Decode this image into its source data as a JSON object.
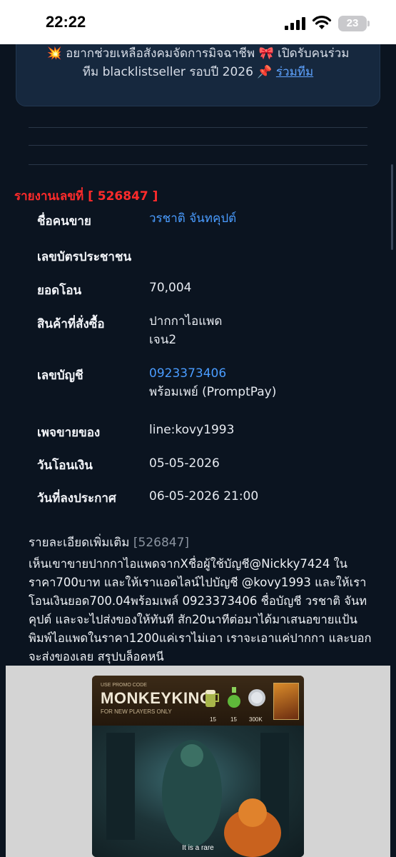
{
  "status_bar": {
    "time": "22:22",
    "battery": "23"
  },
  "banner": {
    "line1": "💥 อยากช่วยเหลือสังคมจัดการมิจฉาชีพ 🎀 เปิดรับคนร่วม",
    "line2": "ทีม blacklistseller รอบปี 2026 📌 ",
    "link": "ร่วมทีม"
  },
  "report": {
    "title": "รายงานเลขที่ [ 526847 ]",
    "rows": [
      {
        "label": "ชื่อคนขาย",
        "value": "วรชาติ จันทคุปต์"
      },
      {
        "label": "เลขบัตรประชาชน",
        "value": ""
      },
      {
        "label": "ยอดโอน",
        "value": "70,004"
      },
      {
        "label": "สินค้าที่สั่งซื้อ",
        "value": "ปากกาไอแพด",
        "value2": "เจน2"
      },
      {
        "label": "เลขบัญชี",
        "value": "0923373406",
        "value2": "พร้อมเพย์ (PromptPay)"
      },
      {
        "label": "เพจขายของ",
        "value": "line:kovy1993"
      },
      {
        "label": "วันโอนเงิน",
        "value": "05-05-2026"
      },
      {
        "label": "วันที่ลงประกาศ",
        "value": "06-05-2026 21:00"
      }
    ]
  },
  "details": {
    "heading": "รายละเอียดเพิ่มเติม ",
    "id": "[526847]",
    "body": "เห็นเขาขายปากกาไอแพดจากXชื่อผู้ใช้บัญชี@Nickky7424 ในราคา700บาท และให้เราแอดไลน์ไปบัญชี @kovy1993 และให้เราโอนเงินยอด700.04พร้อมเพล์ 0923373406 ชื่อบัญชี วรชาติ จันทคุปต์ และจะไปส่งของให้ทันที สัก20นาทีต่อมาได้มาเสนอขายแป้นพิมพ์ไอแพดในราคา1200แค่เราไม่เอา เราจะเอาแค่ปากกา และบอกจะส่งของเลย สรุปบล็อคหนี"
  },
  "ad": {
    "promo": "USE PROMO CODE",
    "brand": "MONKEYKING",
    "sub": "FOR NEW PLAYERS ONLY",
    "n1": "15",
    "n2": "15",
    "n3": "300K",
    "caption": "It is a rare"
  }
}
